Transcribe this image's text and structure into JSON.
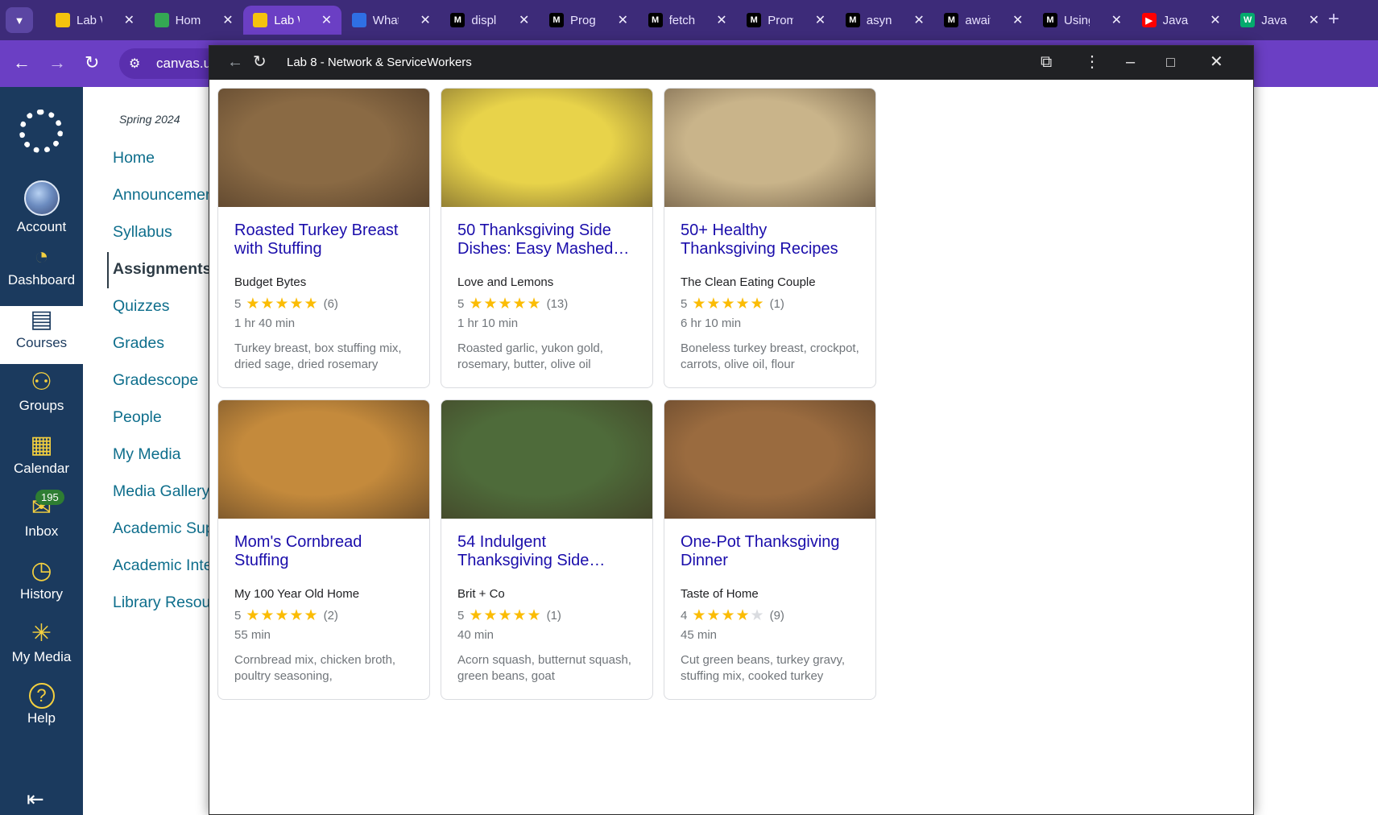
{
  "browser": {
    "tabs": [
      {
        "title": "Lab W",
        "favicon": "canvas-lab-icon",
        "color": "#f4c20d"
      },
      {
        "title": "Home",
        "favicon": "google-drive-icon",
        "color": "#34a853"
      },
      {
        "title": "Lab W",
        "favicon": "canvas-lab-icon",
        "color": "#f4c20d",
        "active": true
      },
      {
        "title": "What",
        "favicon": "azure-icon",
        "color": "#2f6fe4"
      },
      {
        "title": "displ",
        "favicon": "mdn-icon",
        "color": "#000000"
      },
      {
        "title": "Progr",
        "favicon": "mdn-icon",
        "color": "#000000"
      },
      {
        "title": "fetch",
        "favicon": "mdn-icon",
        "color": "#000000"
      },
      {
        "title": "Prom",
        "favicon": "mdn-icon",
        "color": "#000000"
      },
      {
        "title": "async",
        "favicon": "mdn-icon",
        "color": "#000000"
      },
      {
        "title": "await",
        "favicon": "mdn-icon",
        "color": "#000000"
      },
      {
        "title": "Using",
        "favicon": "mdn-icon",
        "color": "#000000"
      },
      {
        "title": "JavaS",
        "favicon": "youtube-icon",
        "color": "#ff0000"
      },
      {
        "title": "JavaS",
        "favicon": "w3schools-icon",
        "color": "#04aa6d"
      }
    ],
    "url_text": "canvas.u"
  },
  "popup": {
    "title": "Lab 8 - Network & ServiceWorkers"
  },
  "global_nav": {
    "items": [
      {
        "label": "Account",
        "icon": "avatar"
      },
      {
        "label": "Dashboard",
        "icon": "dashboard-icon"
      },
      {
        "label": "Courses",
        "icon": "courses-icon",
        "active": true
      },
      {
        "label": "Groups",
        "icon": "groups-icon"
      },
      {
        "label": "Calendar",
        "icon": "calendar-icon"
      },
      {
        "label": "Inbox",
        "icon": "inbox-icon",
        "badge": "195"
      },
      {
        "label": "History",
        "icon": "history-icon"
      },
      {
        "label": "My Media",
        "icon": "my-media-icon"
      },
      {
        "label": "Help",
        "icon": "help-icon"
      }
    ]
  },
  "course_nav": {
    "term": "Spring 2024",
    "links": [
      {
        "label": "Home"
      },
      {
        "label": "Announcements"
      },
      {
        "label": "Syllabus"
      },
      {
        "label": "Assignments",
        "active": true
      },
      {
        "label": "Quizzes"
      },
      {
        "label": "Grades"
      },
      {
        "label": "Gradescope"
      },
      {
        "label": "People"
      },
      {
        "label": "My Media"
      },
      {
        "label": "Media Gallery"
      },
      {
        "label": "Academic Support"
      },
      {
        "label": "Academic Integrity"
      },
      {
        "label": "Library Resources"
      }
    ]
  },
  "recipes": [
    {
      "title": "Roasted Turkey Breast with Stuffing",
      "source": "Budget Bytes",
      "rating": "5",
      "stars": 5,
      "count": "(6)",
      "time": "1 hr 40 min",
      "ingredients": "Turkey breast, box stuffing mix, dried sage, dried rosemary",
      "img_color": "#8a6a44"
    },
    {
      "title": "50 Thanksgiving Side Dishes: Easy Mashed…",
      "source": "Love and Lemons",
      "rating": "5",
      "stars": 5,
      "count": "(13)",
      "time": "1 hr 10 min",
      "ingredients": "Roasted garlic, yukon gold, rosemary, butter, olive oil",
      "img_color": "#e8d34a"
    },
    {
      "title": "50+ Healthy Thanksgiving Recipes",
      "source": "The Clean Eating Couple",
      "rating": "5",
      "stars": 5,
      "count": "(1)",
      "time": "6 hr 10 min",
      "ingredients": "Boneless turkey breast, crockpot, carrots, olive oil, flour",
      "img_color": "#c9b48a"
    },
    {
      "title": "Mom's Cornbread Stuffing",
      "source": "My 100 Year Old Home",
      "rating": "5",
      "stars": 5,
      "count": "(2)",
      "time": "55 min",
      "ingredients": "Cornbread mix, chicken broth, poultry seasoning,",
      "img_color": "#c48a3c"
    },
    {
      "title": "54 Indulgent Thanksgiving Side…",
      "source": "Brit + Co",
      "rating": "5",
      "stars": 5,
      "count": "(1)",
      "time": "40 min",
      "ingredients": "Acorn squash, butternut squash, green beans, goat",
      "img_color": "#4e6b3a"
    },
    {
      "title": "One-Pot Thanksgiving Dinner",
      "source": "Taste of Home",
      "rating": "4",
      "stars": 4,
      "count": "(9)",
      "time": "45 min",
      "ingredients": "Cut green beans, turkey gravy, stuffing mix, cooked turkey",
      "img_color": "#9a6b3f"
    }
  ]
}
